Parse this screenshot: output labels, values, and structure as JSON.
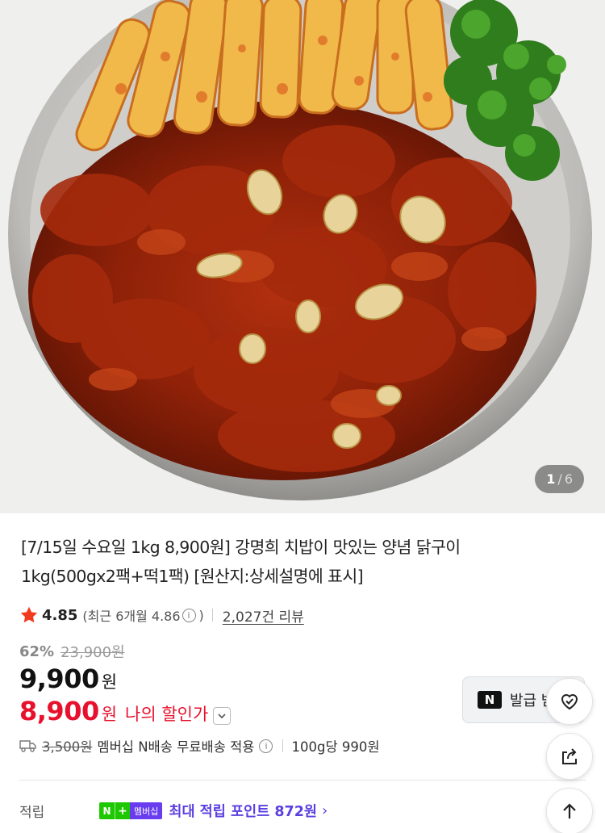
{
  "image_viewer": {
    "current": "1",
    "separator": "/",
    "total": "6"
  },
  "product": {
    "title": "[7/15일 수요일 1kg 8,900원] 강명희 치밥이 맛있는 양념 닭구이 1kg(500gx2팩+떡1팩) [원산지:상세설명에 표시]",
    "rating": "4.85",
    "recent_prefix": "(최근 6개월 4.86",
    "recent_suffix": ")",
    "info_glyph": "i",
    "review_count": "2,027건 리뷰",
    "discount_rate": "62%",
    "original_price": "23,900원",
    "price": "9,900",
    "price_unit": "원",
    "my_price": "8,900",
    "my_price_unit": "원",
    "my_price_label": "나의 할인가"
  },
  "coupon": {
    "logo": "N",
    "label": "발급 받기"
  },
  "shipping": {
    "fee": "3,500원",
    "text": "멤버십 N배송 무료배송 적용",
    "per_unit": "100g당 990원"
  },
  "points": {
    "label": "적립",
    "badge_n": "N",
    "badge_plus": "+",
    "badge_member": "멤버십",
    "text": "최대 적립 포인트 872원",
    "chevron": "›"
  },
  "colors": {
    "accent_red": "#e8112d",
    "star": "#f23a1e",
    "naver_green": "#1ec800",
    "membership_purple": "#5b3fe0"
  },
  "icons": {
    "favorite": "heart-check-icon",
    "share": "share-icon",
    "scroll_top": "arrow-up-icon",
    "rating": "star-icon",
    "delivery": "truck-icon"
  }
}
